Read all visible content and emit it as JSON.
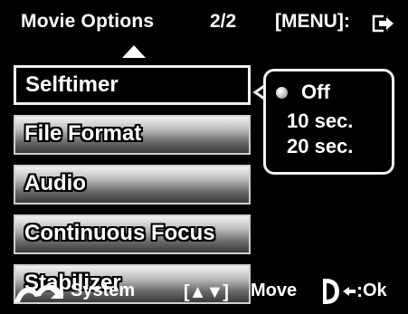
{
  "header": {
    "title": "Movie Options",
    "page": "2/2",
    "menu_hint": "[MENU]:",
    "exit_icon": "exit-arrow-icon",
    "up_icon": "triangle-up-icon"
  },
  "menu": {
    "items": [
      {
        "label": "Selftimer",
        "selected": true
      },
      {
        "label": "File Format",
        "selected": false
      },
      {
        "label": "Audio",
        "selected": false
      },
      {
        "label": "Continuous Focus",
        "selected": false
      },
      {
        "label": "Stabilizer",
        "selected": false
      }
    ]
  },
  "submenu": {
    "options": [
      "Off",
      "10 sec.",
      "20 sec."
    ],
    "selected": "Off"
  },
  "footer": {
    "system_label": "System",
    "move_arrows": "[▲▼]",
    "move_label": "Move",
    "ok_label": "Ok"
  },
  "colors": {
    "background": "#000000",
    "text": "#ffffff",
    "item_gradient_top": "#f2f2f2",
    "item_gradient_bottom": "#3a3a3a",
    "border": "#f0f0f0"
  }
}
